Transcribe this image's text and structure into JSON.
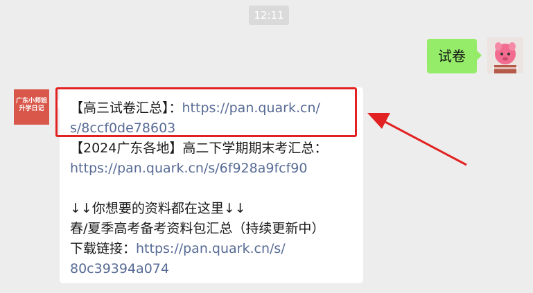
{
  "chat": {
    "timestamp": "12:11",
    "me_message": "试卷",
    "other_avatar": {
      "line1": "广东小师姐",
      "line2": "升学日记"
    },
    "reply": {
      "line1_text": "【高三试卷汇总】：",
      "line1_link": "https://pan.quark.cn/",
      "line2_link": "s/8ccf0de78603",
      "line3_text": "【2024广东各地】高二下学期期末考汇总：",
      "line4_link": "https://pan.quark.cn/s/6f928a9fcf90",
      "line6_text": "↓↓你想要的资料都在这里↓↓",
      "line7_text": "春/夏季高考备考资料包汇总（持续更新中）",
      "line8_text": "下载链接：",
      "line8_link": "https://pan.quark.cn/s/",
      "line9_link": "80c39394a074"
    }
  },
  "colors": {
    "background": "#ededed",
    "my_bubble": "#95ec69",
    "link": "#576b95",
    "highlight": "#e22222",
    "other_avatar_bg": "#d9574a"
  }
}
